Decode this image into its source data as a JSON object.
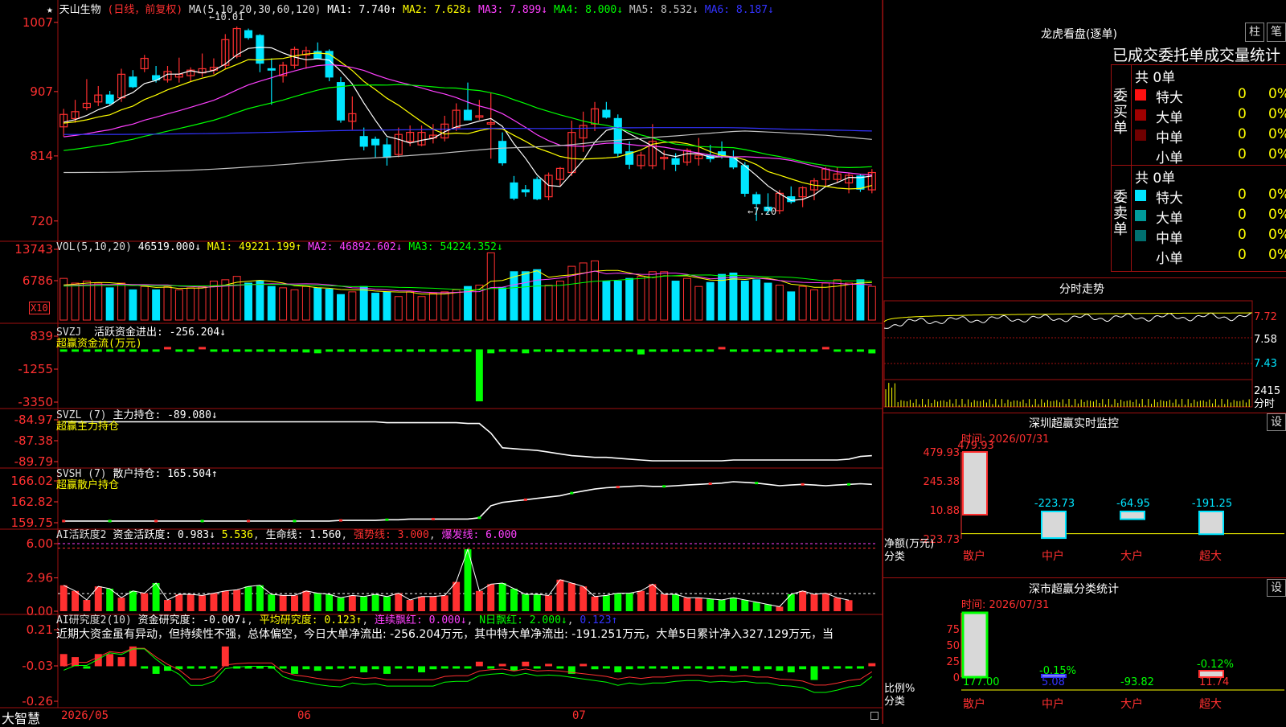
{
  "colors": {
    "up": "#ff3030",
    "down": "#00e5ff",
    "grid": "#a01010",
    "white": "#ffffff",
    "yellow": "#ffff00",
    "magenta": "#ff40ff",
    "green": "#00ff00",
    "blue": "#3333ff",
    "gray": "#c0c0c0"
  },
  "main": {
    "star": "★",
    "stock_name": "天山生物",
    "period": "(日线，前复权)",
    "ma_label": "MA(5,10,20,30,60,120)",
    "ma": [
      {
        "text": "MA1: 7.740↑",
        "color": "#ffffff"
      },
      {
        "text": "MA2: 7.628↓",
        "color": "#ffff00"
      },
      {
        "text": "MA3: 7.899↓",
        "color": "#ff40ff"
      },
      {
        "text": "MA4: 8.000↓",
        "color": "#00ff00"
      },
      {
        "text": "MA5: 8.532↓",
        "color": "#c0c0c0"
      },
      {
        "text": "MA6: 8.187↓",
        "color": "#3333ff"
      }
    ],
    "y_ticks": [
      "1007",
      "907",
      "814",
      "720"
    ],
    "high_label": "←10.01",
    "low_label": "←7.20"
  },
  "vol": {
    "label": "VOL(5,10,20)",
    "value": "46519.000↓",
    "ma": [
      {
        "text": "MA1: 49221.199↑",
        "color": "#ffff00"
      },
      {
        "text": "MA2: 46892.602↓",
        "color": "#ff40ff"
      },
      {
        "text": "MA3: 54224.352↓",
        "color": "#00ff00"
      }
    ],
    "y_ticks": [
      "13743",
      "6786"
    ],
    "unit": "X10"
  },
  "svzj": {
    "label": "SVZJ",
    "desc": "活跃资金进出: -256.204↓",
    "sub": "超赢资金流(万元)",
    "y_ticks": [
      "839",
      "-1255",
      "-3350"
    ]
  },
  "svzl": {
    "label": "SVZL (7)",
    "desc": "主力持仓: -89.080↓",
    "sub": "超赢主力持仓",
    "y_ticks": [
      "-84.97",
      "-87.38",
      "-89.79"
    ]
  },
  "svsh": {
    "label": "SVSH (7)",
    "desc": "散户持仓: 165.504↑",
    "sub": "超赢散户持仓",
    "y_ticks": [
      "166.02",
      "162.82",
      "159.75"
    ]
  },
  "ai1": {
    "label": "AI活跃度2",
    "desc": "资金活跃度: 0.983↓",
    "v2": "5.536",
    "v3": "生命线: 1.560",
    "v4": "强势线: 3.000",
    "v5": "爆发线: 6.000",
    "y_ticks": [
      "6.00",
      "2.96",
      "0.00"
    ]
  },
  "ai2": {
    "label": "AI研究度2(10)",
    "desc": "资金研究度: -0.007↓",
    "v2": "平均研究度: 0.123↑",
    "v3": "连续飘红: 0.000↓",
    "v4": "N日飘红: 2.000↓",
    "v5": "0.123↑",
    "comment": "近期大资金虽有异动，但持续性不强，总体偏空，今日大单净流出: -256.204万元，其中特大单净流出: -191.251万元，大单5日累计净入327.129万元，当",
    "y_ticks": [
      "0.21",
      "-0.03",
      "-0.26"
    ]
  },
  "xaxis": {
    "app": "大智慧",
    "labels": [
      "2026/05",
      "06",
      "07"
    ]
  },
  "lhb": {
    "title": "龙虎看盘(逐单)",
    "btn1": "柱",
    "btn2": "笔",
    "heading": "已成交委托单成交量统计",
    "buy": {
      "side": "委买单",
      "total": "共 0单",
      "rows": [
        {
          "name": "特大",
          "v": "0",
          "p": "0%",
          "color": "#ff1010"
        },
        {
          "name": "大单",
          "v": "0",
          "p": "0%",
          "color": "#a00000"
        },
        {
          "name": "中单",
          "v": "0",
          "p": "0%",
          "color": "#700000"
        },
        {
          "name": "小单",
          "v": "0",
          "p": "0%",
          "color": ""
        }
      ]
    },
    "sell": {
      "side": "委卖单",
      "total": "共 0单",
      "rows": [
        {
          "name": "特大",
          "v": "0",
          "p": "0%",
          "color": "#00e5ff"
        },
        {
          "name": "大单",
          "v": "0",
          "p": "0%",
          "color": "#009a9a"
        },
        {
          "name": "中单",
          "v": "0",
          "p": "0%",
          "color": "#007070"
        },
        {
          "name": "小单",
          "v": "0",
          "p": "0%",
          "color": ""
        }
      ]
    }
  },
  "intraday": {
    "title": "分时走势",
    "y_ticks": [
      "7.72",
      "7.58",
      "7.43"
    ],
    "vol_top": "2415",
    "vol_unit": "分时"
  },
  "monitor": {
    "title": "深圳超赢实时监控",
    "btn": "设",
    "time": "时间: 2026/07/31",
    "y_ticks": [
      "479.93",
      "245.38",
      "10.88",
      "-223.73"
    ],
    "y_label1": "净额(万元)",
    "y_label2": "分类",
    "bars": [
      {
        "cat": "散户",
        "value": 479.93,
        "label": "479.93"
      },
      {
        "cat": "中户",
        "value": -223.73,
        "label": "-223.73"
      },
      {
        "cat": "大户",
        "value": -64.95,
        "label": "-64.95"
      },
      {
        "cat": "超大",
        "value": -191.25,
        "label": "-191.25"
      }
    ]
  },
  "classify": {
    "title": "深市超赢分类统计",
    "btn": "设",
    "time": "时间: 2026/07/31",
    "y_ticks": [
      "75",
      "50",
      "25",
      "0"
    ],
    "y_label1": "比例%",
    "y_label2": "分类",
    "bars": [
      {
        "cat": "散户",
        "pct": 100,
        "value": "177.00",
        "label": ""
      },
      {
        "cat": "中户",
        "pct": -0.15,
        "value": "5.08",
        "label": "-0.15%"
      },
      {
        "cat": "大户",
        "pct": 0,
        "value": "-93.82",
        "label": ""
      },
      {
        "cat": "超大",
        "pct": -0.12,
        "value": "11.74",
        "label": "-0.12%"
      }
    ]
  },
  "chart_data": {
    "type": "candlestick",
    "candles": [
      {
        "o": 8.56,
        "h": 8.82,
        "l": 8.42,
        "c": 8.74
      },
      {
        "o": 8.68,
        "h": 8.95,
        "l": 8.62,
        "c": 8.78
      },
      {
        "o": 8.84,
        "h": 9.25,
        "l": 8.8,
        "c": 8.9
      },
      {
        "o": 8.92,
        "h": 9.15,
        "l": 8.86,
        "c": 9.02
      },
      {
        "o": 9.02,
        "h": 9.08,
        "l": 8.88,
        "c": 8.9
      },
      {
        "o": 8.98,
        "h": 9.4,
        "l": 8.92,
        "c": 9.32
      },
      {
        "o": 9.28,
        "h": 9.38,
        "l": 9.12,
        "c": 9.14
      },
      {
        "o": 9.4,
        "h": 9.6,
        "l": 9.35,
        "c": 9.55
      },
      {
        "o": 9.3,
        "h": 9.44,
        "l": 9.2,
        "c": 9.24
      },
      {
        "o": 9.24,
        "h": 9.44,
        "l": 9.2,
        "c": 9.36
      },
      {
        "o": 9.28,
        "h": 9.56,
        "l": 9.2,
        "c": 9.32
      },
      {
        "o": 9.3,
        "h": 9.42,
        "l": 9.22,
        "c": 9.38
      },
      {
        "o": 9.34,
        "h": 9.62,
        "l": 9.28,
        "c": 9.4
      },
      {
        "o": 9.38,
        "h": 9.55,
        "l": 9.32,
        "c": 9.42
      },
      {
        "o": 9.45,
        "h": 9.9,
        "l": 9.4,
        "c": 9.82
      },
      {
        "o": 9.58,
        "h": 10.01,
        "l": 9.55,
        "c": 9.98
      },
      {
        "o": 9.95,
        "h": 9.98,
        "l": 9.82,
        "c": 9.85
      },
      {
        "o": 9.88,
        "h": 9.9,
        "l": 9.35,
        "c": 9.48
      },
      {
        "o": 9.4,
        "h": 9.55,
        "l": 8.88,
        "c": 9.38
      },
      {
        "o": 9.3,
        "h": 9.5,
        "l": 9.2,
        "c": 9.45
      },
      {
        "o": 9.45,
        "h": 9.72,
        "l": 9.4,
        "c": 9.68
      },
      {
        "o": 9.6,
        "h": 9.72,
        "l": 9.4,
        "c": 9.66
      },
      {
        "o": 9.65,
        "h": 9.78,
        "l": 9.55,
        "c": 9.55
      },
      {
        "o": 9.65,
        "h": 9.68,
        "l": 9.22,
        "c": 9.28
      },
      {
        "o": 9.2,
        "h": 9.28,
        "l": 8.62,
        "c": 8.66
      },
      {
        "o": 8.64,
        "h": 9.0,
        "l": 8.52,
        "c": 8.75
      },
      {
        "o": 8.42,
        "h": 8.55,
        "l": 8.22,
        "c": 8.28
      },
      {
        "o": 8.38,
        "h": 8.42,
        "l": 8.12,
        "c": 8.3
      },
      {
        "o": 8.3,
        "h": 8.4,
        "l": 8.0,
        "c": 8.12
      },
      {
        "o": 8.16,
        "h": 8.55,
        "l": 8.12,
        "c": 8.45
      },
      {
        "o": 8.35,
        "h": 8.58,
        "l": 8.28,
        "c": 8.48
      },
      {
        "o": 8.3,
        "h": 8.58,
        "l": 8.28,
        "c": 8.48
      },
      {
        "o": 8.4,
        "h": 8.6,
        "l": 8.32,
        "c": 8.44
      },
      {
        "o": 8.4,
        "h": 8.72,
        "l": 8.35,
        "c": 8.6
      },
      {
        "o": 8.55,
        "h": 8.9,
        "l": 8.5,
        "c": 8.8
      },
      {
        "o": 8.8,
        "h": 9.2,
        "l": 8.7,
        "c": 8.66
      },
      {
        "o": 8.7,
        "h": 8.95,
        "l": 8.66,
        "c": 8.72
      },
      {
        "o": 8.6,
        "h": 9.05,
        "l": 8.1,
        "c": 8.62
      },
      {
        "o": 8.35,
        "h": 8.48,
        "l": 8.0,
        "c": 8.04
      },
      {
        "o": 7.75,
        "h": 7.85,
        "l": 7.5,
        "c": 7.53
      },
      {
        "o": 7.65,
        "h": 7.72,
        "l": 7.55,
        "c": 7.62
      },
      {
        "o": 7.8,
        "h": 7.84,
        "l": 7.5,
        "c": 7.52
      },
      {
        "o": 7.55,
        "h": 7.9,
        "l": 7.5,
        "c": 7.86
      },
      {
        "o": 7.8,
        "h": 7.98,
        "l": 7.7,
        "c": 7.96
      },
      {
        "o": 7.9,
        "h": 8.65,
        "l": 7.85,
        "c": 8.48
      },
      {
        "o": 8.4,
        "h": 8.78,
        "l": 8.2,
        "c": 8.58
      },
      {
        "o": 8.6,
        "h": 8.92,
        "l": 8.5,
        "c": 8.82
      },
      {
        "o": 8.8,
        "h": 8.92,
        "l": 8.68,
        "c": 8.7
      },
      {
        "o": 8.68,
        "h": 8.74,
        "l": 8.12,
        "c": 8.18
      },
      {
        "o": 8.2,
        "h": 8.35,
        "l": 7.95,
        "c": 8.02
      },
      {
        "o": 8.0,
        "h": 8.2,
        "l": 7.95,
        "c": 8.15
      },
      {
        "o": 8.0,
        "h": 8.6,
        "l": 7.95,
        "c": 8.35
      },
      {
        "o": 8.1,
        "h": 8.22,
        "l": 7.94,
        "c": 8.12
      },
      {
        "o": 8.1,
        "h": 8.18,
        "l": 7.92,
        "c": 8.02
      },
      {
        "o": 8.05,
        "h": 8.25,
        "l": 8.0,
        "c": 8.22
      },
      {
        "o": 8.1,
        "h": 8.4,
        "l": 8.0,
        "c": 8.15
      },
      {
        "o": 8.15,
        "h": 8.3,
        "l": 8.05,
        "c": 8.1
      },
      {
        "o": 8.2,
        "h": 8.35,
        "l": 8.1,
        "c": 8.15
      },
      {
        "o": 8.12,
        "h": 8.22,
        "l": 7.95,
        "c": 7.98
      },
      {
        "o": 8.0,
        "h": 8.05,
        "l": 7.55,
        "c": 7.6
      },
      {
        "o": 7.58,
        "h": 7.62,
        "l": 7.2,
        "c": 7.45
      },
      {
        "o": 7.4,
        "h": 7.6,
        "l": 7.3,
        "c": 7.35
      },
      {
        "o": 7.35,
        "h": 7.65,
        "l": 7.3,
        "c": 7.6
      },
      {
        "o": 7.55,
        "h": 7.7,
        "l": 7.45,
        "c": 7.48
      },
      {
        "o": 7.55,
        "h": 7.7,
        "l": 7.4,
        "c": 7.68
      },
      {
        "o": 7.65,
        "h": 7.82,
        "l": 7.5,
        "c": 7.78
      },
      {
        "o": 7.8,
        "h": 7.98,
        "l": 7.7,
        "c": 7.95
      },
      {
        "o": 7.8,
        "h": 7.98,
        "l": 7.75,
        "c": 7.88
      },
      {
        "o": 7.75,
        "h": 7.9,
        "l": 7.6,
        "c": 7.86
      },
      {
        "o": 7.85,
        "h": 7.88,
        "l": 7.62,
        "c": 7.66
      },
      {
        "o": 7.65,
        "h": 7.95,
        "l": 7.6,
        "c": 7.9
      }
    ],
    "volume_rel": [
      0.62,
      0.55,
      0.58,
      0.55,
      0.48,
      0.55,
      0.45,
      0.5,
      0.45,
      0.5,
      0.45,
      0.48,
      0.5,
      0.58,
      0.6,
      0.65,
      0.55,
      0.58,
      0.5,
      0.48,
      0.45,
      0.5,
      0.48,
      0.46,
      0.38,
      0.42,
      0.5,
      0.4,
      0.42,
      0.35,
      0.42,
      0.35,
      0.4,
      0.42,
      0.45,
      0.5,
      0.52,
      1.0,
      0.48,
      0.72,
      0.72,
      0.75,
      0.52,
      0.58,
      0.8,
      0.85,
      0.88,
      0.58,
      0.58,
      0.62,
      0.65,
      0.72,
      0.72,
      0.58,
      0.62,
      0.5,
      0.56,
      0.68,
      0.7,
      0.58,
      0.6,
      0.55,
      0.52,
      0.42,
      0.5,
      0.45,
      0.55,
      0.6,
      0.55,
      0.6,
      0.5
    ],
    "svzj": [
      -50,
      -30,
      -40,
      -30,
      -20,
      -30,
      -20,
      -30,
      -20,
      60,
      -40,
      -20,
      60,
      -30,
      -40,
      -30,
      -20,
      -30,
      -20,
      -40,
      -30,
      -200,
      -250,
      -30,
      -30,
      -30,
      -20,
      -20,
      -40,
      -30,
      -30,
      -20,
      -30,
      -30,
      -20,
      -20,
      -3300,
      -250,
      -20,
      -80,
      -250,
      -20,
      -40,
      -180,
      -30,
      -40,
      -30,
      -20,
      -60,
      -80,
      -320,
      -100,
      -30,
      -20,
      -40,
      -20,
      -40,
      50,
      -30,
      -30,
      -40,
      -30,
      -200,
      -40,
      -30,
      -50,
      60,
      -40,
      -50,
      -40,
      -256
    ],
    "svzl": [
      -85.2,
      -85.2,
      -85.2,
      -85.2,
      -85.2,
      -85.2,
      -85.2,
      -85.2,
      -85.2,
      -85.2,
      -85.2,
      -85.2,
      -85.2,
      -85.2,
      -85.2,
      -85.2,
      -85.2,
      -85.2,
      -85.2,
      -85.2,
      -85.2,
      -85.2,
      -85.2,
      -85.2,
      -85.2,
      -85.2,
      -85.2,
      -85.2,
      -85.3,
      -85.3,
      -85.3,
      -85.3,
      -85.3,
      -85.3,
      -85.3,
      -85.4,
      -85.4,
      -86.5,
      -88.2,
      -88.3,
      -88.4,
      -88.5,
      -88.7,
      -88.9,
      -89.1,
      -89.2,
      -89.3,
      -89.3,
      -89.4,
      -89.5,
      -89.6,
      -89.7,
      -89.7,
      -89.7,
      -89.7,
      -89.7,
      -89.7,
      -89.7,
      -89.6,
      -89.6,
      -89.6,
      -89.6,
      -89.6,
      -89.6,
      -89.6,
      -89.6,
      -89.6,
      -89.6,
      -89.5,
      -89.2,
      -89.1,
      -89.3
    ],
    "svsh": [
      160.0,
      160.0,
      160.0,
      160.0,
      160.0,
      160.0,
      160.0,
      160.0,
      160.0,
      160.0,
      160.0,
      160.0,
      160.0,
      160.0,
      160.0,
      160.0,
      160.0,
      160.0,
      160.0,
      160.0,
      160.0,
      160.0,
      160.0,
      160.0,
      160.1,
      160.1,
      160.1,
      160.1,
      160.2,
      160.2,
      160.3,
      160.3,
      160.3,
      160.3,
      160.3,
      160.3,
      160.5,
      162.3,
      162.8,
      163.0,
      163.2,
      163.4,
      163.6,
      163.8,
      164.2,
      164.5,
      164.8,
      165.0,
      165.1,
      165.2,
      165.3,
      165.2,
      165.2,
      165.3,
      165.4,
      165.5,
      165.6,
      165.7,
      165.9,
      165.8,
      165.7,
      165.5,
      165.3,
      165.4,
      165.5,
      165.4,
      165.3,
      165.4,
      165.5,
      165.6,
      165.5
    ],
    "ai1": [
      2.3,
      1.8,
      1.0,
      2.2,
      2.0,
      1.2,
      1.8,
      1.6,
      2.5,
      1.0,
      1.5,
      1.5,
      1.4,
      1.6,
      1.8,
      1.9,
      2.2,
      2.3,
      1.5,
      1.4,
      1.4,
      1.8,
      1.6,
      1.5,
      1.2,
      1.4,
      1.3,
      1.5,
      1.3,
      1.6,
      1.0,
      1.3,
      1.3,
      1.4,
      2.6,
      5.5,
      1.8,
      2.4,
      2.5,
      2.0,
      1.5,
      1.5,
      1.4,
      2.8,
      2.5,
      2.2,
      1.3,
      1.4,
      1.6,
      1.6,
      1.8,
      2.4,
      1.5,
      1.5,
      1.2,
      1.2,
      1.1,
      1.0,
      1.2,
      1.0,
      0.8,
      0.6,
      0.4,
      1.5,
      1.8,
      1.5,
      1.6,
      1.2,
      0.98
    ],
    "ai2": [
      0.05,
      0.03,
      -0.03,
      0.05,
      0.05,
      0.03,
      0.1,
      -0.03,
      -0.08,
      -0.06,
      -0.05,
      -0.04,
      -0.03,
      -0.03,
      0.1,
      -0.03,
      -0.03,
      -0.03,
      -0.03,
      -0.03,
      -0.08,
      -0.05,
      -0.06,
      -0.05,
      -0.04,
      -0.03,
      -0.07,
      -0.05,
      -0.08,
      -0.04,
      -0.03,
      -0.07,
      -0.05,
      -0.03,
      -0.03,
      -0.03,
      0.0,
      -0.03,
      -0.02,
      -0.06,
      0.0,
      -0.03,
      -0.02,
      -0.03,
      -0.08,
      -0.02,
      -0.05,
      -0.04,
      -0.07,
      -0.05,
      -0.04,
      -0.03,
      -0.04,
      -0.05,
      -0.04,
      -0.04,
      -0.05,
      -0.03,
      -0.06,
      -0.03,
      -0.06,
      -0.05,
      -0.06,
      -0.07,
      -0.05,
      -0.12,
      -0.05,
      -0.03,
      -0.03,
      -0.03,
      -0.01
    ]
  }
}
